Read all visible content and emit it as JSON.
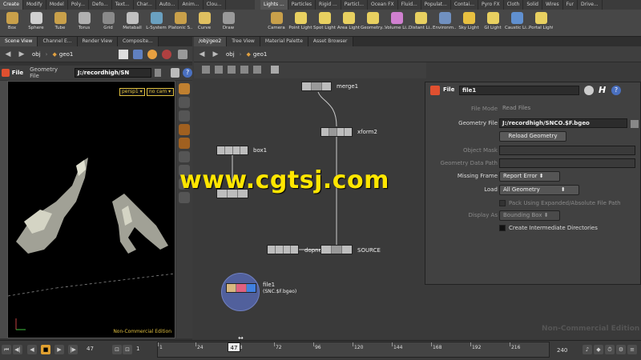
{
  "shelf": {
    "left_tabs": [
      "Create",
      "Modify",
      "Model",
      "Poly...",
      "Defo...",
      "Text...",
      "Char...",
      "Auto...",
      "Anim...",
      "Clou..."
    ],
    "right_tabs": [
      "Lights ...",
      "Particles",
      "Rigid ...",
      "Particl...",
      "Ocean FX",
      "Fluid...",
      "Populat...",
      "Contai...",
      "Pyro FX",
      "Cloth",
      "Solid",
      "Wires",
      "Fur",
      "Drive..."
    ],
    "left_tools": [
      {
        "label": "Box",
        "icon": "box-icon",
        "color": "#c9a04a"
      },
      {
        "label": "Sphere",
        "icon": "sphere-icon",
        "color": "#d0d0d0"
      },
      {
        "label": "Tube",
        "icon": "tube-icon",
        "color": "#c9a04a"
      },
      {
        "label": "Torus",
        "icon": "torus-icon",
        "color": "#b0b0b0"
      },
      {
        "label": "Grid",
        "icon": "grid-icon",
        "color": "#8a8a8a"
      },
      {
        "label": "Metaball",
        "icon": "metaball-icon",
        "color": "#c0c0c0"
      },
      {
        "label": "L-System",
        "icon": "lsystem-icon",
        "color": "#6aa0c0"
      },
      {
        "label": "Platonic S...",
        "icon": "platonic-icon",
        "color": "#c9a04a"
      },
      {
        "label": "Curve",
        "icon": "curve-icon",
        "color": "#e0c060"
      },
      {
        "label": "Draw",
        "icon": "draw-icon",
        "color": "#9a9a9a"
      }
    ],
    "right_tools": [
      {
        "label": "Camera",
        "icon": "camera-icon",
        "color": "#c9a04a"
      },
      {
        "label": "Point Light",
        "icon": "point-light-icon",
        "color": "#e8d060"
      },
      {
        "label": "Spot Light",
        "icon": "spot-light-icon",
        "color": "#e8d060"
      },
      {
        "label": "Area Light",
        "icon": "area-light-icon",
        "color": "#e8d060"
      },
      {
        "label": "Geometry...",
        "icon": "geometry-light-icon",
        "color": "#e8d060"
      },
      {
        "label": "Volume Li...",
        "icon": "volume-light-icon",
        "color": "#d080d0"
      },
      {
        "label": "Distant Li...",
        "icon": "distant-light-icon",
        "color": "#e8d060"
      },
      {
        "label": "Environm...",
        "icon": "environment-light-icon",
        "color": "#7090c0"
      },
      {
        "label": "Sky Light",
        "icon": "sky-light-icon",
        "color": "#e8c040"
      },
      {
        "label": "GI Light",
        "icon": "gi-light-icon",
        "color": "#e8d060"
      },
      {
        "label": "Caustic Li...",
        "icon": "caustic-light-icon",
        "color": "#6090d0"
      },
      {
        "label": "Portal Light",
        "icon": "portal-light-icon",
        "color": "#e8d060"
      }
    ]
  },
  "left_pane": {
    "tabs": [
      "Scene View",
      "Channel E...",
      "Render View",
      "Composite..."
    ],
    "path": [
      "obj",
      "geo1"
    ],
    "header_label": "File",
    "header_field_label": "Geometry File",
    "header_field_value": "J:/recordhigh/SN",
    "viewport_cam": "persp1",
    "viewport_nocam": "no cam",
    "watermark_text": "Non-Commercial Edition"
  },
  "network": {
    "tabs": [
      "/obj/geo2",
      "Tree View",
      "Material Palette",
      "Asset Browser"
    ],
    "path": [
      "obj",
      "geo1"
    ],
    "nodes": [
      {
        "label": "merge1"
      },
      {
        "label": "xform2"
      },
      {
        "label": "box1"
      },
      {
        "label": "dopne"
      },
      {
        "label": "SOURCE"
      },
      {
        "label": "file1"
      }
    ],
    "file_node_sublabel": "(SNC.$F.bgeo)",
    "corner_watermark": "Non-Commercial Edition"
  },
  "params": {
    "header_label": "File",
    "node_name": "file1",
    "rows": {
      "file_mode": {
        "label": "File Mode",
        "value": "Read Files"
      },
      "geometry_file": {
        "label": "Geometry File",
        "value": "J:/recordhigh/SNCO.$F.bgeo"
      },
      "reload_button": "Reload Geometry",
      "object_mask": {
        "label": "Object Mask"
      },
      "geometry_data_path": {
        "label": "Geometry Data Path"
      },
      "missing_frame": {
        "label": "Missing Frame",
        "value": "Report Error"
      },
      "load": {
        "label": "Load",
        "value": "All Geometry"
      },
      "pack_checkbox": "Pack Using Expanded/Absolute File Path",
      "display_as": {
        "label": "Display As",
        "value": "Bounding Box"
      },
      "intermediate_checkbox": "Create Intermediate Directories"
    }
  },
  "timeline": {
    "current_frame": "47",
    "start_frame": "1",
    "playhead_frame": "47",
    "end_frame": "240",
    "ticks": [
      "1",
      "24",
      "48",
      "72",
      "96",
      "120",
      "144",
      "168",
      "192",
      "216"
    ]
  },
  "overlay_watermark": "www.cgtsj.com"
}
